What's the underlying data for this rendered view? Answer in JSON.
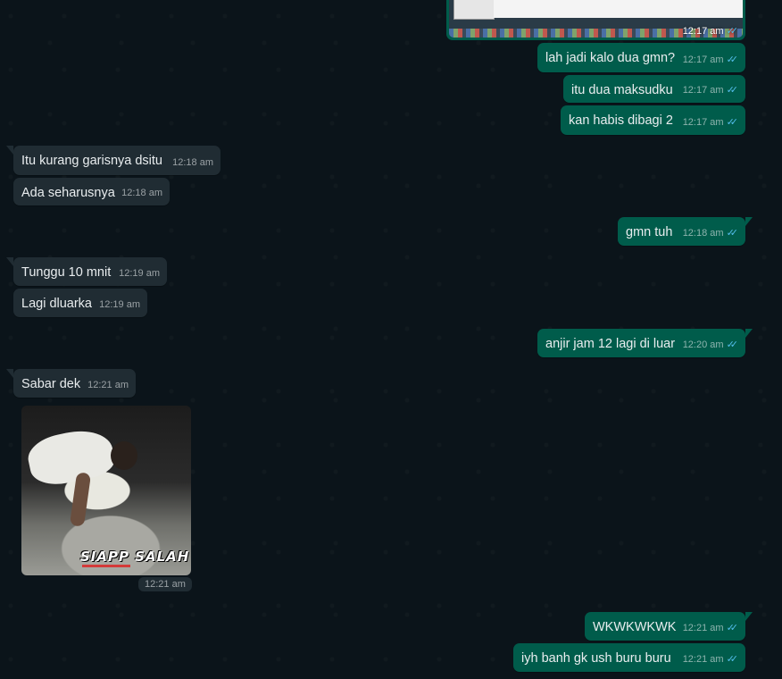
{
  "colors": {
    "background": "#0b141a",
    "outgoing_bubble": "#005c4b",
    "incoming_bubble": "#202c33",
    "read_tick": "#53bdeb"
  },
  "top_image": {
    "time": "12:17 am",
    "status_icon": "double-check-read-icon"
  },
  "messages": [
    {
      "side": "out",
      "text": "lah jadi kalo dua gmn?",
      "time": "12:17 am"
    },
    {
      "side": "out",
      "text": "itu dua maksudku",
      "time": "12:17 am"
    },
    {
      "side": "out",
      "text": "kan habis dibagi 2",
      "time": "12:17 am"
    },
    {
      "side": "in",
      "text": "Itu kurang garisnya dsitu",
      "time": "12:18 am"
    },
    {
      "side": "in",
      "text": "Ada seharusnya",
      "time": "12:18 am"
    },
    {
      "side": "out",
      "text": "gmn tuh",
      "time": "12:18 am"
    },
    {
      "side": "in",
      "text": "Tunggu 10 mnit",
      "time": "12:19 am"
    },
    {
      "side": "in",
      "text": "Lagi dluarka",
      "time": "12:19 am"
    },
    {
      "side": "out",
      "text": "anjir jam 12 lagi di luar",
      "time": "12:20 am"
    },
    {
      "side": "in",
      "text": "Sabar dek",
      "time": "12:21 am"
    },
    {
      "side": "out",
      "text": "WKWKWKWK",
      "time": "12:21 am"
    },
    {
      "side": "out",
      "text": "iyh banh gk ush buru buru",
      "time": "12:21 am"
    }
  ],
  "sticker": {
    "caption": "SIAPP SALAH",
    "time": "12:21 am"
  },
  "tick_glyph": "✓✓"
}
